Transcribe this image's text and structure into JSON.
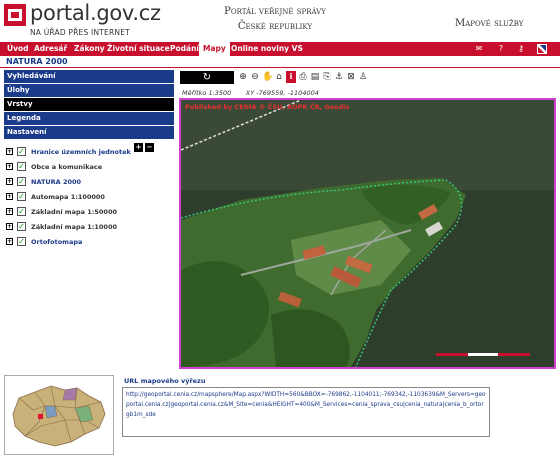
{
  "header": {
    "logo_main": "portal.gov.cz",
    "logo_sub": "NA ÚŘAD PŘES INTERNET",
    "portal_title_line1": "Portál veřejné správy",
    "portal_title_line2": "České republiky",
    "section_title": "Mapové služby"
  },
  "nav": {
    "items": [
      {
        "label": "Úvod"
      },
      {
        "label": "Adresář"
      },
      {
        "label": "Zákony"
      },
      {
        "label": "Životní situace"
      },
      {
        "label": "Podání"
      },
      {
        "label": "Mapy"
      },
      {
        "label": "Online noviny VS"
      }
    ],
    "icons": [
      "mail-icon",
      "help-icon",
      "key-icon",
      "flag-uk-icon"
    ]
  },
  "page": {
    "title": "NATURA 2000"
  },
  "sidebar": {
    "headers": [
      {
        "label": "Vyhledávání"
      },
      {
        "label": "Úlohy"
      },
      {
        "label": "Vrstvy"
      },
      {
        "label": "Legenda"
      },
      {
        "label": "Nastavení"
      }
    ],
    "expand_all": "+",
    "collapse_all": "−",
    "layers": [
      {
        "label": "Hranice územních jednotek",
        "style": "link"
      },
      {
        "label": "Obce a komunikace",
        "style": "plain"
      },
      {
        "label": "NATURA 2000",
        "style": "link"
      },
      {
        "label": "Automapa 1:100000",
        "style": "plain"
      },
      {
        "label": "Základní mapa 1:50000",
        "style": "plain"
      },
      {
        "label": "Základní mapa 1:10000",
        "style": "plain"
      },
      {
        "label": "Ortofotomapa",
        "style": "link"
      }
    ]
  },
  "map": {
    "refresh_glyph": "↻",
    "tools": [
      "zoom-in-icon",
      "zoom-out-icon",
      "pan-icon",
      "home-icon",
      "info-icon",
      "print-icon",
      "export-icon",
      "print-icon-2",
      "anchor-icon",
      "measure-icon",
      "user-icon"
    ],
    "scale_label": "Měřítko 1:3500",
    "coords": "XY -769559, -1104004",
    "attribution": "Published by CENIA  © ČSÚ, AOPK ČR, Geodis"
  },
  "url_section": {
    "label": "URL mapového výřezu",
    "value": "http://geoportal.cenia.cz/mapsphere/Map.aspx?WIDTH=560&BBOX=-769862,-1104011;-769342,-1103639&M_Servers=geoportal.cenia.cz|geoportal.cenia.cz&M_Site=cenia&HEIGHT=400&M_Services=cenia_sprava_csu|cenia_natura|cenia_b_ortorgb1m_sde"
  },
  "colors": {
    "brand_red": "#c8102e",
    "nav_blue": "#1a3a8a",
    "map_border": "#d040d0"
  }
}
